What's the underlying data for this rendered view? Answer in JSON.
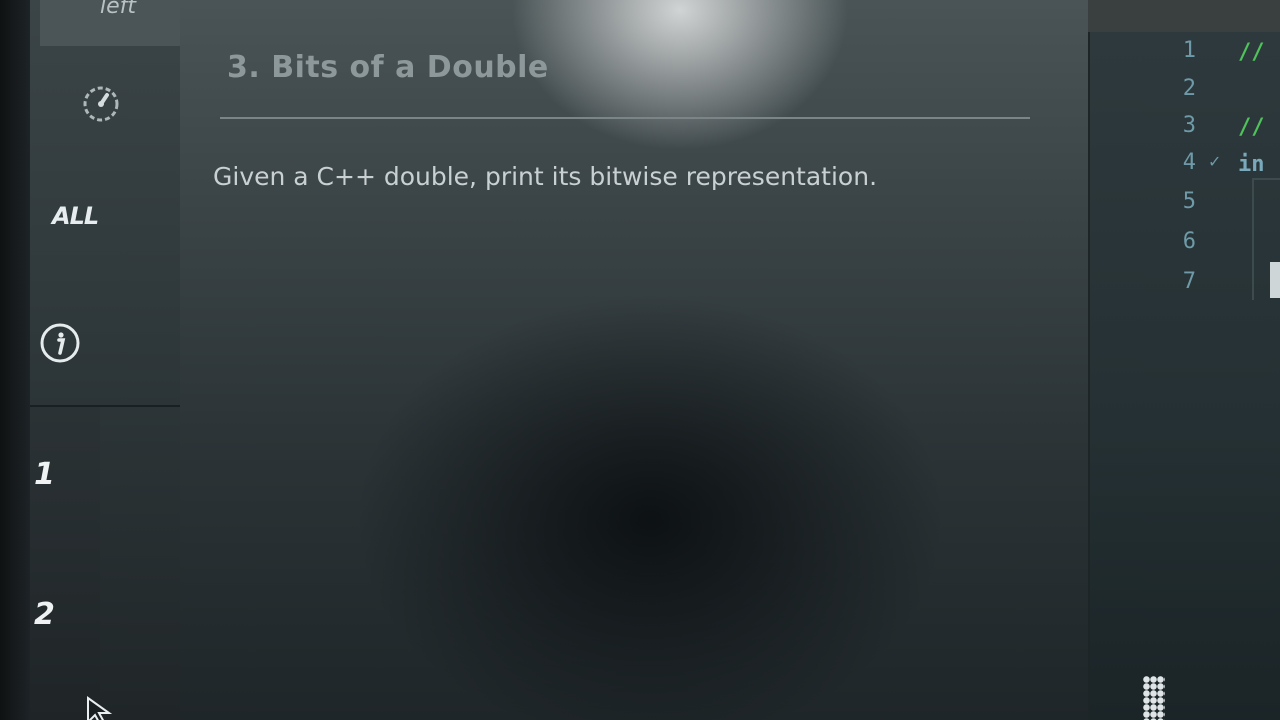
{
  "sidebar": {
    "top_label": "left",
    "all_label": "ALL",
    "problems": [
      "1",
      "2"
    ],
    "icons": {
      "dial": "dial-icon",
      "info": "info-icon"
    }
  },
  "problem": {
    "title": "3. Bits of a Double",
    "description": "Given a C++ double, print its bitwise representation."
  },
  "editor": {
    "line_numbers": [
      "1",
      "2",
      "3",
      "4",
      "5",
      "6",
      "7"
    ],
    "code_line_1": "//",
    "code_line_3": "//",
    "code_line_4": "in"
  },
  "colors": {
    "accent_code_comment": "#4fc25a",
    "background": "#2a3134"
  }
}
